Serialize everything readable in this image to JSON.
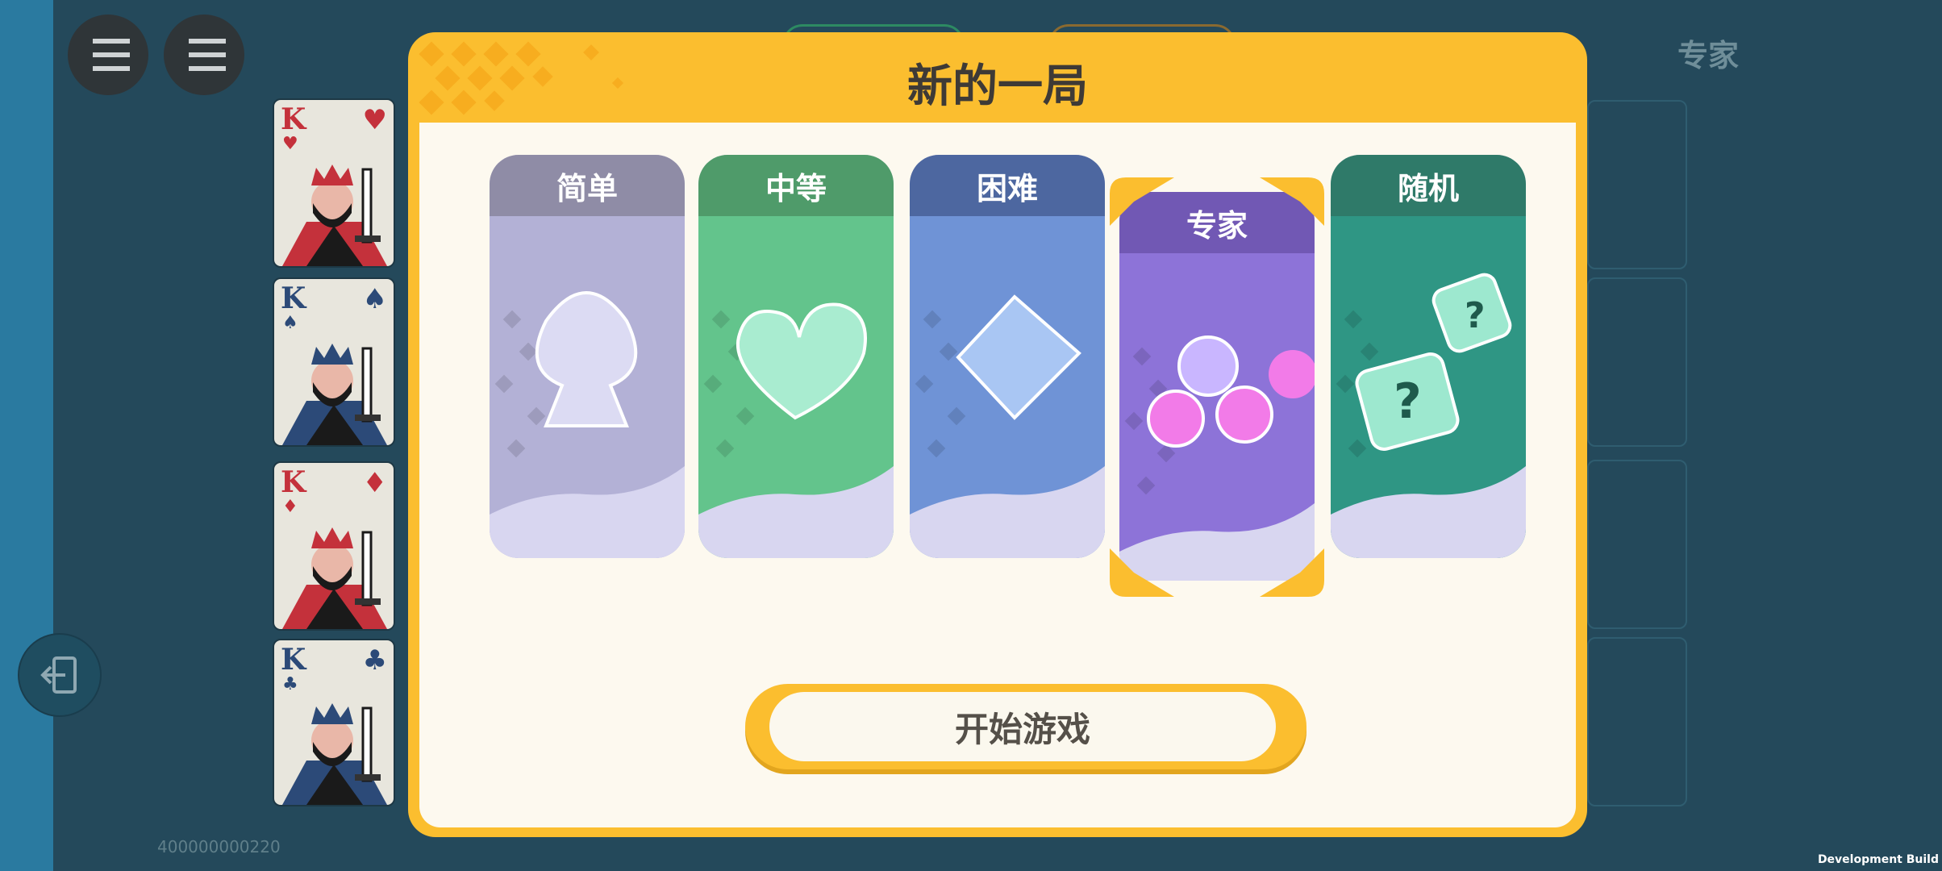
{
  "modal": {
    "title": "新的一局",
    "start_button": "开始游戏",
    "difficulties": [
      {
        "label": "简单",
        "header_color": "#8f8ca6",
        "bg_color": "#b3b1d6",
        "icon": "spade-icon"
      },
      {
        "label": "中等",
        "header_color": "#4f9b6a",
        "bg_color": "#63c48c",
        "icon": "heart-icon"
      },
      {
        "label": "困难",
        "header_color": "#4d67a0",
        "bg_color": "#6f93d6",
        "icon": "diamond-icon"
      },
      {
        "label": "专家",
        "header_color": "#7158b4",
        "bg_color": "#8d73d8",
        "icon": "club-icon",
        "selected": true
      },
      {
        "label": "随机",
        "header_color": "#2f7a69",
        "bg_color": "#2f9684",
        "icon": "dice-icon"
      }
    ]
  },
  "background": {
    "top_right_label": "专家",
    "seed": "400000000220",
    "dev_build": "Development Build",
    "cards": [
      {
        "rank": "K",
        "suit": "♥",
        "color": "#c4313b"
      },
      {
        "rank": "K",
        "suit": "♠",
        "color": "#2c4a78"
      },
      {
        "rank": "K",
        "suit": "♦",
        "color": "#c4313b"
      },
      {
        "rank": "K",
        "suit": "♣",
        "color": "#2c4a78"
      }
    ]
  },
  "icons": {
    "menu_1": "list-icon",
    "menu_2": "list-icon",
    "exit": "exit-icon"
  },
  "colors": {
    "accent": "#fbbe2f",
    "panel": "#fdf9ef",
    "table": "#24495b"
  }
}
